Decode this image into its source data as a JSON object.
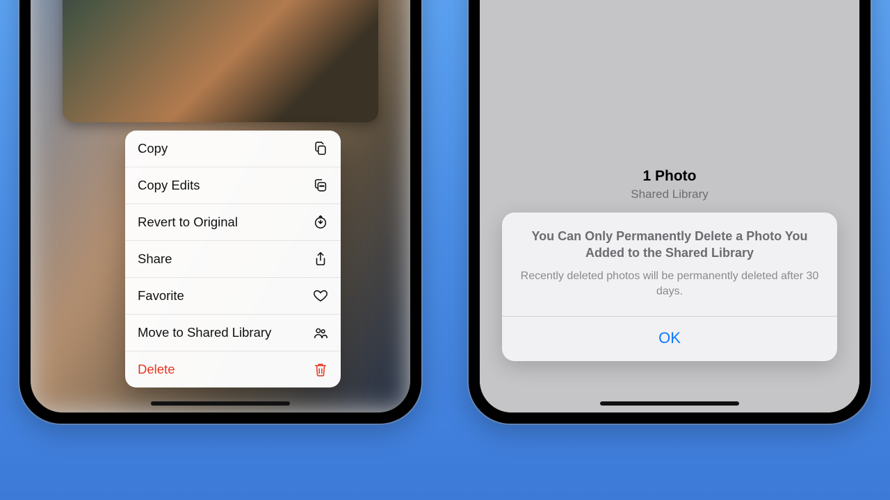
{
  "left": {
    "menu": {
      "copy": "Copy",
      "copy_edits": "Copy Edits",
      "revert": "Revert to Original",
      "share": "Share",
      "favorite": "Favorite",
      "move_shared": "Move to Shared Library",
      "delete": "Delete"
    }
  },
  "right": {
    "header_count": "1 Photo",
    "header_sub": "Shared Library",
    "alert_title": "You Can Only Permanently Delete a Photo You Added to the Shared Library",
    "alert_message": "Recently deleted photos will be permanently deleted after 30 days.",
    "alert_ok": "OK"
  },
  "colors": {
    "destructive": "#e8341f",
    "link": "#0a7aff"
  }
}
